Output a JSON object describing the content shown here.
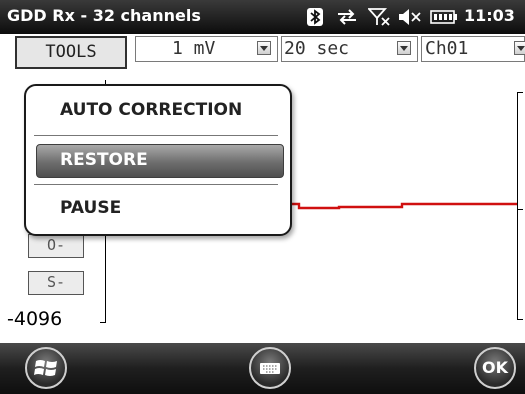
{
  "status_bar": {
    "title": "GDD Rx - 32 channels",
    "time": "11:03",
    "icons": [
      "bluetooth-icon",
      "sync-icon",
      "no-signal-icon",
      "volume-muted-icon",
      "battery-icon"
    ]
  },
  "toolbar": {
    "tools_label": "TOOLS",
    "voltage_value": "1 mV",
    "time_value": "20 sec",
    "channel_value": "Ch01"
  },
  "plot": {
    "ymin_label": "-4096",
    "side_buttons": [
      "O-",
      "S-"
    ],
    "signal_color": "#d01010"
  },
  "popup_menu": {
    "items": [
      "AUTO CORRECTION",
      "RESTORE",
      "PAUSE"
    ],
    "selected": "RESTORE"
  },
  "bottom_bar": {
    "ok_label": "OK",
    "buttons": [
      "start-menu-icon",
      "keyboard-icon",
      "ok-button"
    ]
  }
}
